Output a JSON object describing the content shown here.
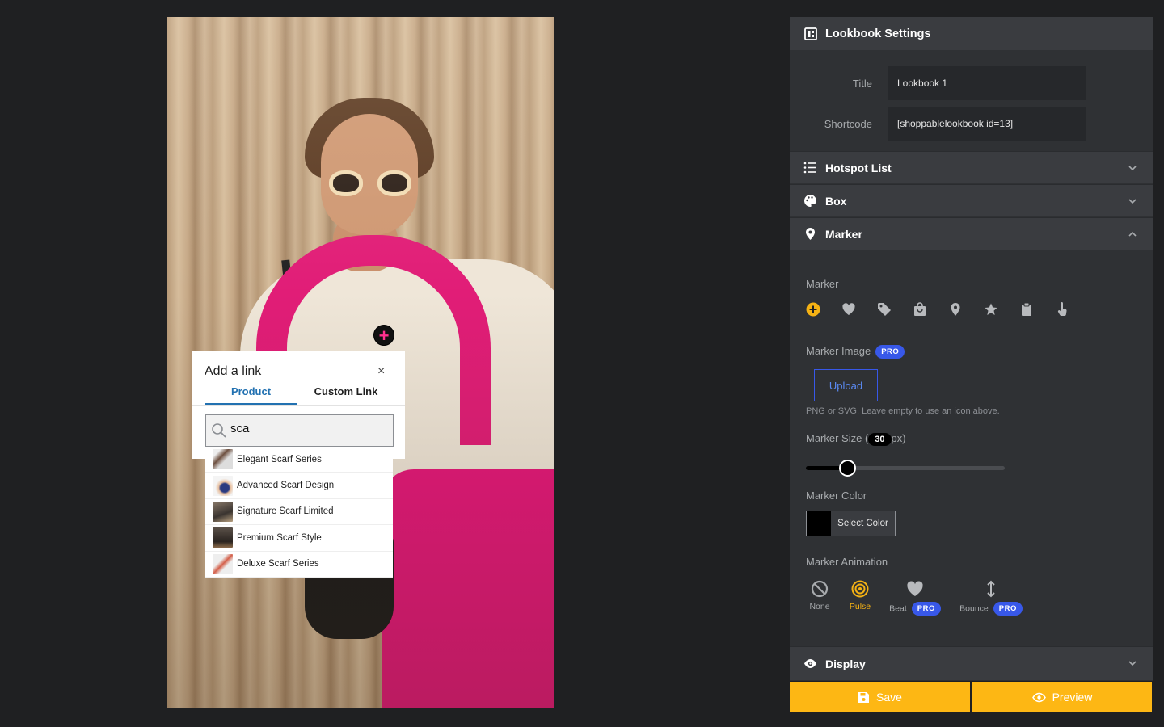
{
  "popup": {
    "title": "Add a link",
    "close_glyph": "×",
    "tabs": [
      {
        "label": "Product"
      },
      {
        "label": "Custom Link"
      }
    ],
    "search_value": "sca",
    "results": [
      {
        "label": "Elegant Scarf Series",
        "thumb_color": "#c9b29a"
      },
      {
        "label": "Advanced Scarf Design",
        "thumb_color": "#8aa0c8"
      },
      {
        "label": "Signature Scarf Limited",
        "thumb_color": "#6e5b4a"
      },
      {
        "label": "Premium Scarf Style",
        "thumb_color": "#4a4038"
      },
      {
        "label": "Deluxe Scarf Series",
        "thumb_color": "#e0b4a8"
      }
    ]
  },
  "hotspot": {
    "glyph": "+"
  },
  "panel": {
    "title": "Lookbook Settings",
    "fields": [
      {
        "label": "Title",
        "value": "Lookbook 1"
      },
      {
        "label": "Shortcode",
        "value": "[shoppablelookbook id=13]"
      }
    ],
    "sections": {
      "hotspot_list": "Hotspot List",
      "box": "Box",
      "marker": "Marker",
      "display": "Display"
    },
    "marker": {
      "label": "Marker",
      "icons": [
        "plus-circle-icon",
        "heart-icon",
        "tag-icon",
        "shopping-bag-icon",
        "map-pin-icon",
        "star-icon",
        "clipboard-icon",
        "pointer-hand-icon"
      ],
      "image_label": "Marker Image",
      "pro_badge": "PRO",
      "upload_label": "Upload",
      "help_text": "PNG or SVG. Leave empty to use an icon above.",
      "size_label_prefix": "Marker Size (",
      "size_value": "30",
      "size_label_suffix": "px)",
      "size_fraction": 0.21,
      "color_label": "Marker Color",
      "color_button": "Select Color",
      "color_value": "#000000",
      "animation_label": "Marker Animation",
      "animations": [
        {
          "label": "None",
          "pro": false
        },
        {
          "label": "Pulse",
          "pro": false,
          "active": true
        },
        {
          "label": "Beat",
          "pro": true
        },
        {
          "label": "Bounce",
          "pro": true
        }
      ]
    },
    "footer": {
      "save": "Save",
      "preview": "Preview"
    }
  },
  "colors": {
    "accent": "#fdb714",
    "pro": "#3858e9",
    "link": "#2271b1",
    "hotspot": "#ff2f8e"
  }
}
